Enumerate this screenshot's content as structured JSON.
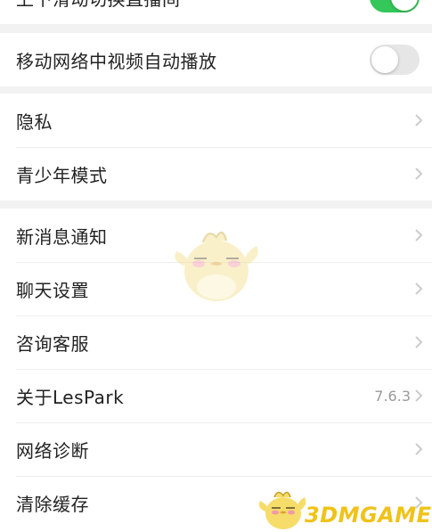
{
  "settings": {
    "partial_top": {
      "label": "上下滑动切换直播间",
      "toggle_on": true
    },
    "mobile_autoplay": {
      "label": "移动网络中视频自动播放",
      "toggle_on": false
    },
    "privacy": {
      "label": "隐私"
    },
    "teen_mode": {
      "label": "青少年模式"
    },
    "notifications": {
      "label": "新消息通知"
    },
    "chat_settings": {
      "label": "聊天设置"
    },
    "customer_service": {
      "label": "咨询客服"
    },
    "about": {
      "label": "关于LesPark",
      "version": "7.6.3"
    },
    "network_diag": {
      "label": "网络诊断"
    },
    "clear_cache": {
      "label": "清除缓存"
    }
  },
  "watermark": {
    "text": "3DMGAME"
  },
  "colors": {
    "toggle_on": "#34c759",
    "toggle_off": "#e6e6e6",
    "chevron": "#c8c8c8"
  }
}
